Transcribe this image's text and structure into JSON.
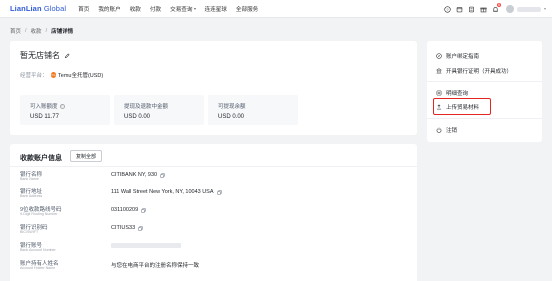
{
  "header": {
    "logo_text": "LianLian",
    "logo_suffix": "Global",
    "nav": [
      {
        "label": "首页"
      },
      {
        "label": "我的账户"
      },
      {
        "label": "收款"
      },
      {
        "label": "付款"
      },
      {
        "label": "交易查询"
      },
      {
        "label": "连连星球"
      },
      {
        "label": "全部服务"
      }
    ],
    "notification_count": "6"
  },
  "breadcrumb": {
    "items": [
      "首页",
      "收款",
      "店铺详情"
    ]
  },
  "store": {
    "name": "暂无店铺名",
    "platform_label": "经营平台：",
    "platform_icon": "Tm",
    "platform_value": "Temu全托管(USD)",
    "balances": [
      {
        "label": "可入账额度",
        "value": "USD 11.77",
        "has_info": true
      },
      {
        "label": "提现及退款中金额",
        "value": "USD 0.00",
        "has_info": false
      },
      {
        "label": "可提现余额",
        "value": "USD 0.00",
        "has_info": false
      }
    ]
  },
  "side_menu": {
    "items": [
      {
        "label": "账户绑定指南",
        "icon": "compass-icon"
      },
      {
        "label": "开具银行证明（开具成功）",
        "icon": "bank-icon"
      },
      {
        "label": "明细查询",
        "icon": "list-icon"
      },
      {
        "label": "上传贸易材料",
        "icon": "upload-icon"
      },
      {
        "label": "注销",
        "icon": "power-icon"
      }
    ],
    "highlight_color": "#e5251f"
  },
  "account": {
    "title": "收款账户信息",
    "copy_all_label": "复制全部",
    "rows": [
      {
        "label_cn": "银行名称",
        "label_en": "Bank Name",
        "value": "CITIBANK NY, 930",
        "copyable": true
      },
      {
        "label_cn": "银行地址",
        "label_en": "Bank Address",
        "value": "111 Wall Street New York, NY, 10043 USA",
        "copyable": true
      },
      {
        "label_cn": "9位收款路线号码",
        "label_en": "9-Digit Routing Number",
        "value": "031100209",
        "copyable": true
      },
      {
        "label_cn": "银行识别码",
        "label_en": "BIC/SWIFT",
        "value": "CITIUS33",
        "copyable": true
      },
      {
        "label_cn": "银行账号",
        "label_en": "Bank Account Number",
        "value": "",
        "copyable": false,
        "redacted": true
      },
      {
        "label_cn": "账户持有人姓名",
        "label_en": "Account Holder Name",
        "value": "与您在电商平台的注册名称保持一致",
        "copyable": false
      }
    ]
  },
  "colors": {
    "brand": "#2f5bd6",
    "background": "#f2f3f5",
    "card": "#ffffff",
    "temu": "#f07b24"
  }
}
